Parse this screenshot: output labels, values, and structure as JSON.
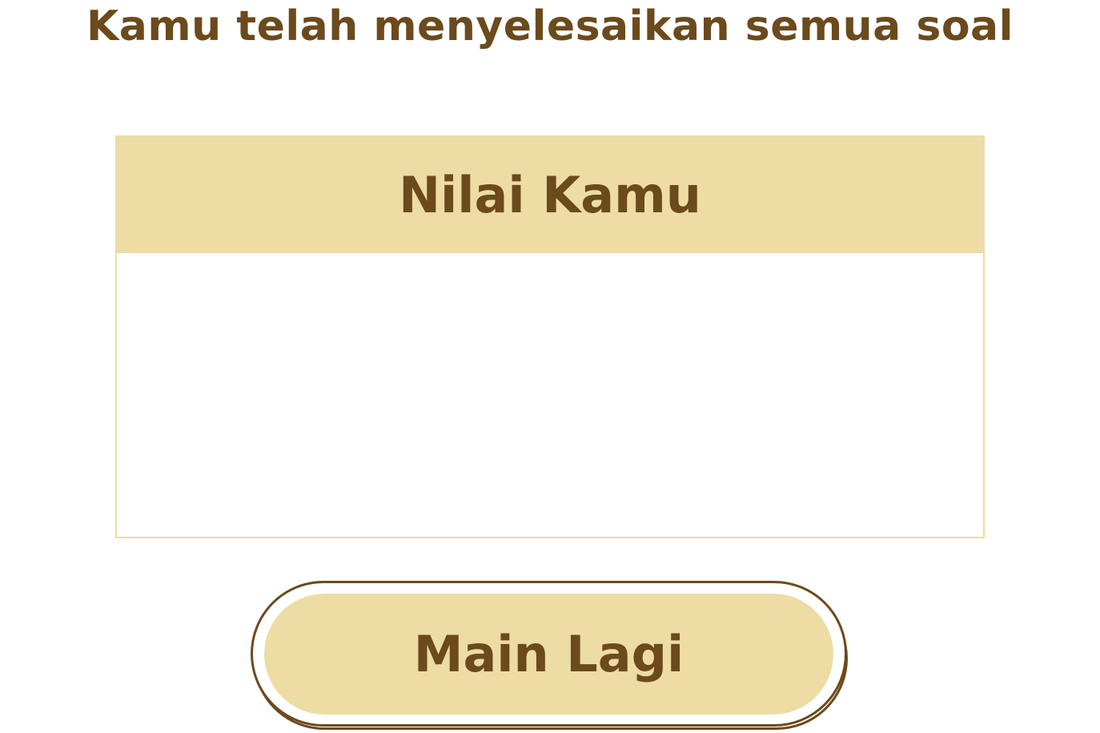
{
  "headline": "Kamu telah menyelesaikan semua soal",
  "score_card": {
    "title": "Nilai Kamu",
    "score": ""
  },
  "play_again": {
    "label": "Main Lagi"
  },
  "colors": {
    "accent": "#eddca4",
    "text": "#6b4a1c",
    "background": "#ffffff"
  }
}
